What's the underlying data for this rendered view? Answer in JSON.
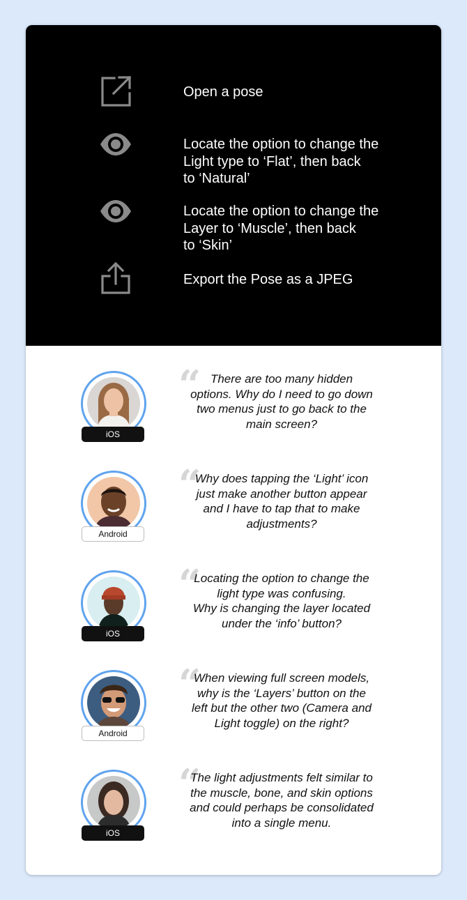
{
  "tasks": [
    {
      "icon": "external-link-icon",
      "text": "Open a pose"
    },
    {
      "icon": "eye-icon",
      "text": "Locate the option to change the\nLight type to ‘Flat’, then back\nto ‘Natural’"
    },
    {
      "icon": "eye-icon",
      "text": "Locate the option to change the\nLayer to ‘Muscle’, then back\nto ‘Skin’"
    },
    {
      "icon": "share-upload-icon",
      "text": "Export the Pose as a JPEG"
    }
  ],
  "feedback": [
    {
      "platform": "iOS",
      "quote": "There are too many hidden\noptions. Why do I need to go down\ntwo menus just to go back to the\nmain screen?"
    },
    {
      "platform": "Android",
      "quote": "Why does tapping the ‘Light’ icon\njust make another button appear\nand I have to tap that to make\nadjustments?"
    },
    {
      "platform": "iOS",
      "quote": "Locating the option to change the\nlight type was confusing.\nWhy is changing the layer located\nunder the ‘info’ button?"
    },
    {
      "platform": "Android",
      "quote": "When viewing full screen models,\nwhy is the ‘Layers’ button on the\nleft but the other two (Camera and\nLight toggle) on the right?"
    },
    {
      "platform": "iOS",
      "quote": "The light adjustments felt similar to\nthe muscle, bone, and skin options\nand could perhaps be consolidated\ninto a single menu."
    }
  ],
  "colors": {
    "background": "#dbe9fb",
    "ring": "#5fa3ee",
    "icon": "#8a8a8a"
  }
}
